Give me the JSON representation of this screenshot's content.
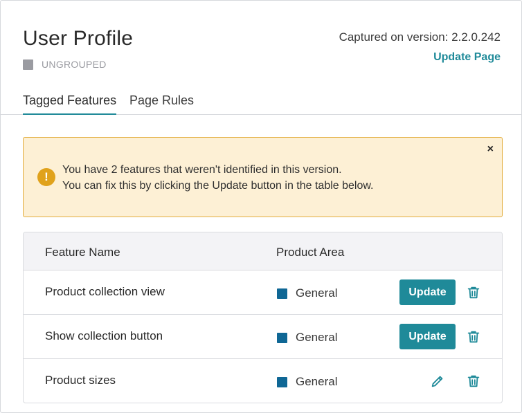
{
  "page": {
    "title": "User Profile",
    "group_label": "UNGROUPED",
    "captured_text": "Captured on version: 2.2.0.242",
    "update_page_label": "Update Page"
  },
  "tabs": [
    {
      "label": "Tagged Features",
      "active": true
    },
    {
      "label": "Page Rules",
      "active": false
    }
  ],
  "alert": {
    "icon": "!",
    "line1": "You have 2 features that weren't identified in this version.",
    "line2": "You can fix this by clicking the Update button in the table below.",
    "close": "×"
  },
  "table": {
    "headers": {
      "name": "Feature Name",
      "area": "Product Area"
    },
    "rows": [
      {
        "name": "Product collection view",
        "area": "General",
        "action": "Update"
      },
      {
        "name": "Show collection button",
        "area": "General",
        "action": "Update"
      },
      {
        "name": "Product sizes",
        "area": "General",
        "action": "edit"
      }
    ]
  },
  "colors": {
    "accent": "#1f8a99",
    "area_swatch": "#0f6795",
    "group_swatch": "#9a9ba1",
    "alert_bg": "#fdf0d5",
    "alert_border": "#e2ac3b"
  },
  "icons": [
    "warning-icon",
    "close-icon",
    "trash-icon",
    "pencil-icon"
  ]
}
